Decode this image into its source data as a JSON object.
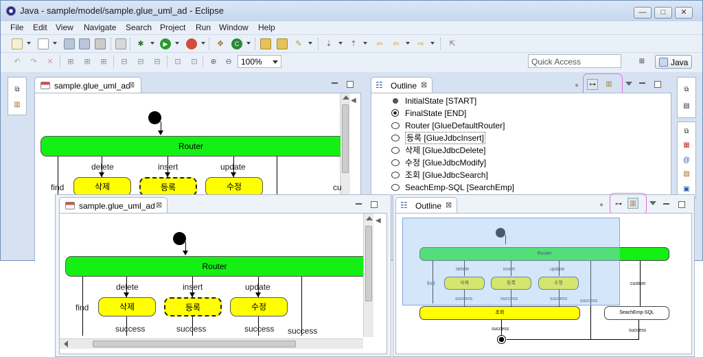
{
  "window": {
    "title": "Java - sample/model/sample.glue_uml_ad - Eclipse",
    "minimize": "—",
    "maximize": "□",
    "close": "✕"
  },
  "menu": [
    "File",
    "Edit",
    "View",
    "Navigate",
    "Search",
    "Project",
    "Run",
    "Window",
    "Help"
  ],
  "toolbar": {
    "zoom_value": "100%",
    "quick_access_placeholder": "Quick Access",
    "perspective_label": "Java"
  },
  "editor": {
    "tab_title": "sample.glue_uml_ad",
    "tab_close": "⊠"
  },
  "outline": {
    "tab_title": "Outline",
    "tab_close": "⊠",
    "items": [
      {
        "icon": "dot",
        "label": "InitialState [START]"
      },
      {
        "icon": "ring",
        "label": "FinalState [END]"
      },
      {
        "icon": "ellipse",
        "label": "Router [GlueDefaultRouter]"
      },
      {
        "icon": "ellipse",
        "label": "등록 [GlueJdbcInsert]"
      },
      {
        "icon": "ellipse",
        "label": "삭제 [GlueJdbcDelete]"
      },
      {
        "icon": "ellipse",
        "label": "수정 [GlueJdbcModify]"
      },
      {
        "icon": "ellipse",
        "label": "조회 [GlueJdbcSearch]"
      },
      {
        "icon": "ellipse",
        "label": "SeachEmp-SQL [SearchEmp]"
      }
    ]
  },
  "diagram": {
    "router": "Router",
    "edges": {
      "delete": "delete",
      "insert": "insert",
      "update": "update",
      "find": "find",
      "success": "success",
      "custom": "custom",
      "cut": "cu"
    },
    "nodes": {
      "delete": "삭제",
      "insert": "등록",
      "update": "수정",
      "search": "조회",
      "sql": "SeachEmp-SQL"
    }
  },
  "colors": {
    "router": "#14f014",
    "activity": "#ffff00",
    "highlight": "#e070e0",
    "outline_selection": "#cfe3fb"
  }
}
